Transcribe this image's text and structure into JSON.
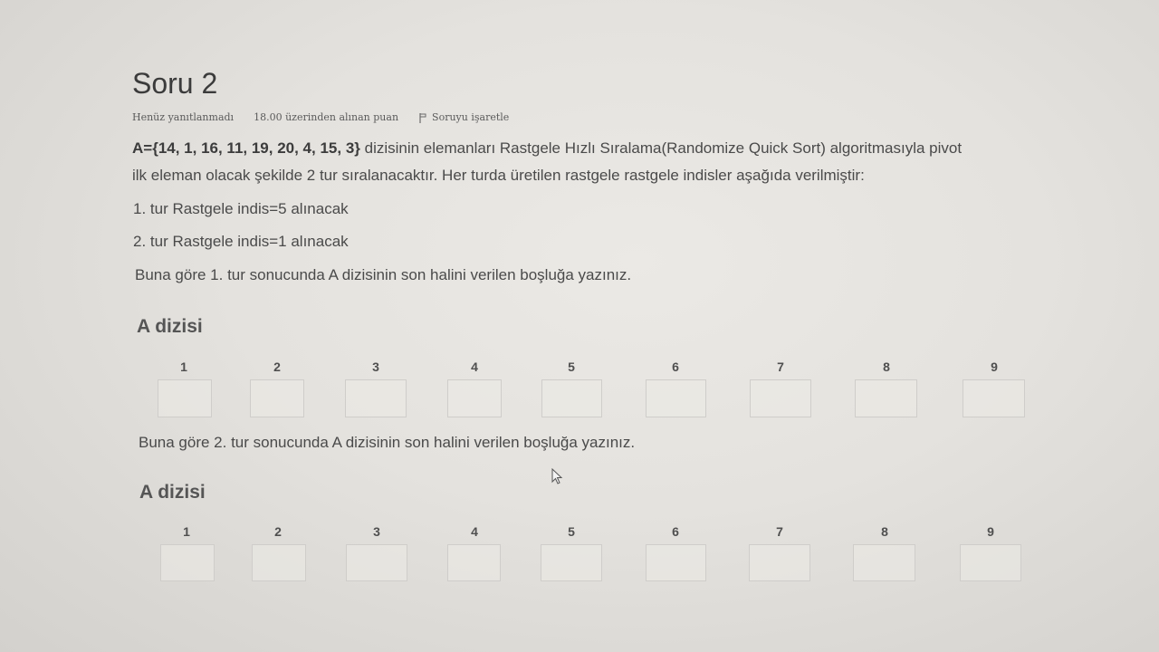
{
  "question": {
    "title": "Soru 2",
    "status": "Henüz yanıtlanmadı",
    "score": "18.00 üzerinden alınan puan",
    "flag_label": "Soruyu işaretle",
    "array_literal": "A={14, 1, 16, 11, 19, 20, 4, 15, 3}",
    "line1_rest": " dizisinin elemanları Rastgele Hızlı Sıralama(Randomize Quick Sort) algoritmasıyla  pivot",
    "line2": "ilk eleman olacak şekilde 2 tur sıralanacaktır. Her turda üretilen rastgele rastgele indisler aşağıda verilmiştir:",
    "round1": "1. tur Rastgele indis=5 alınacak",
    "round2": "2. tur Rastgele indis=1 alınacak",
    "prompt1": "Buna göre 1. tur sonucunda A dizisinin son halini verilen boşluğa yazınız.",
    "prompt2": "Buna göre 2. tur sonucunda A dizisinin son halini verilen boşluğa yazınız."
  },
  "answer_sections": [
    {
      "heading": "A dizisi",
      "indices": [
        "1",
        "2",
        "3",
        "4",
        "5",
        "6",
        "7",
        "8",
        "9"
      ],
      "values": [
        "",
        "",
        "",
        "",
        "",
        "",
        "",
        "",
        ""
      ]
    },
    {
      "heading": "A dizisi",
      "indices": [
        "1",
        "2",
        "3",
        "4",
        "5",
        "6",
        "7",
        "8",
        "9"
      ],
      "values": [
        "",
        "",
        "",
        "",
        "",
        "",
        "",
        "",
        ""
      ]
    }
  ]
}
